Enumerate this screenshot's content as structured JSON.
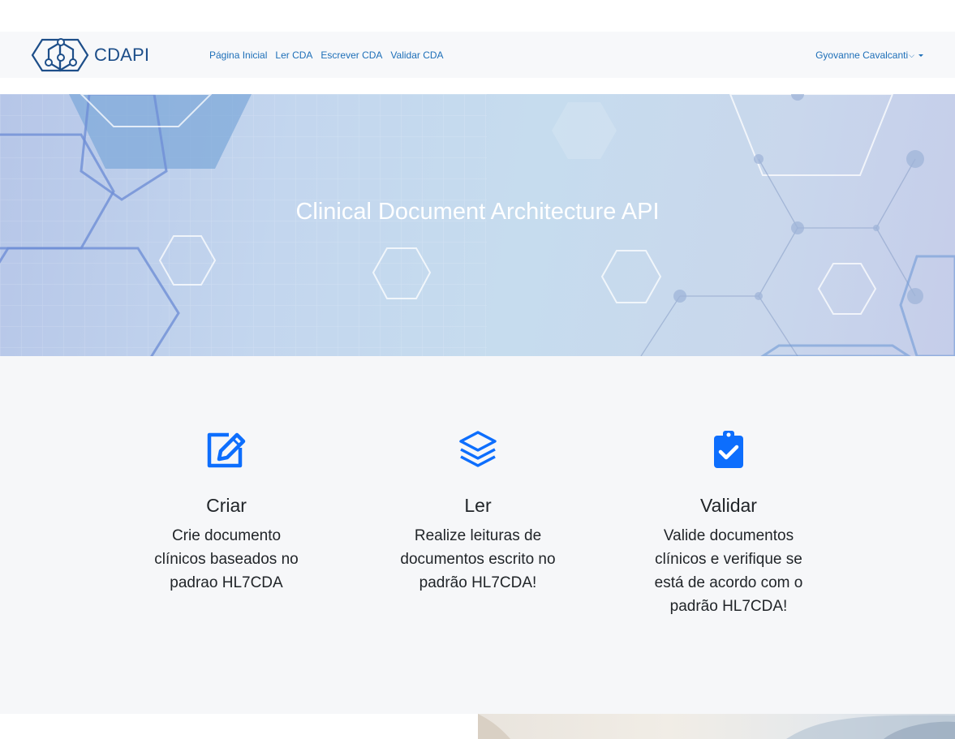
{
  "brand": {
    "name": "CDAPI"
  },
  "nav": {
    "links": [
      "Página Inicial",
      "Ler CDA",
      "Escrever CDA",
      "Validar CDA"
    ],
    "user": "Gyovanne Cavalcanti"
  },
  "hero": {
    "title": "Clinical Document Architecture API"
  },
  "features": [
    {
      "icon": "edit-icon",
      "title": "Criar",
      "text": "Crie documento clínicos baseados no padrao HL7CDA"
    },
    {
      "icon": "layers-icon",
      "title": "Ler",
      "text": "Realize leituras de documentos escrito no padrão HL7CDA!"
    },
    {
      "icon": "clipboard-check-icon",
      "title": "Validar",
      "text": "Valide documentos clínicos e verifique se está de acordo com o padrão HL7CDA!"
    }
  ],
  "colors": {
    "accent": "#0d6efd",
    "brand": "#1d4e89",
    "link": "#1d6fb8"
  }
}
